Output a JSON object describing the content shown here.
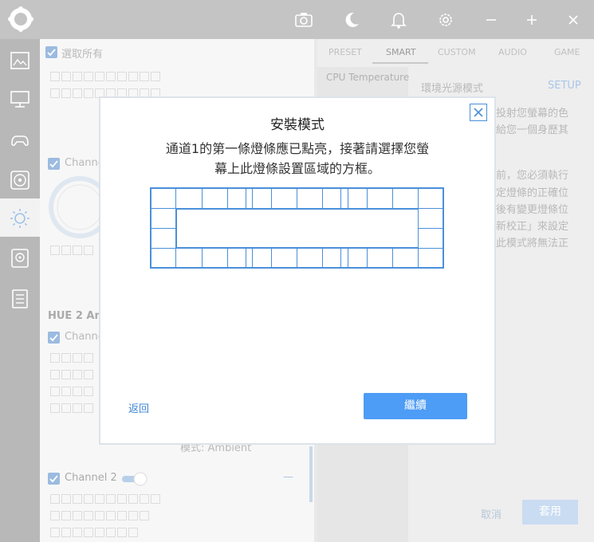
{
  "left_panel": {
    "select_all": "選取所有",
    "channel_label_short": "Channe",
    "group_title_short": "HUE 2 Am",
    "mode_text": "模式: Ambient",
    "channel2_label": "Channel 2",
    "collapse_symbol": "—"
  },
  "right_panel": {
    "tabs": [
      {
        "label": "PRESET"
      },
      {
        "label": "SMART"
      },
      {
        "label": "CUSTOM"
      },
      {
        "label": "AUDIO"
      },
      {
        "label": "GAME"
      }
    ],
    "list_item": "CPU Temperature",
    "mode_title": "環境光源模式",
    "setup_label": "SETUP",
    "desc_fragments": [
      "投射您螢幕的色",
      "給您一個身歷其",
      "前，您必須執行",
      "定燈條的正確位",
      "後有變更燈條位",
      "新校正」來設定",
      "此模式將無法正"
    ],
    "cancel_label": "取消",
    "apply_label": "套用"
  },
  "modal": {
    "title": "安裝模式",
    "description_line1": "通道1的第一條燈條應已點亮，接著請選擇您螢",
    "description_line2": "幕上此燈條設置區域的方框。",
    "back_label": "返回",
    "continue_label": "繼續",
    "close_icon": "close-icon"
  },
  "colors": {
    "accent": "#4a90d9",
    "button": "#4d9cf5",
    "titlebar": "#c4c4c4",
    "sidebar": "#b8b8b8"
  }
}
